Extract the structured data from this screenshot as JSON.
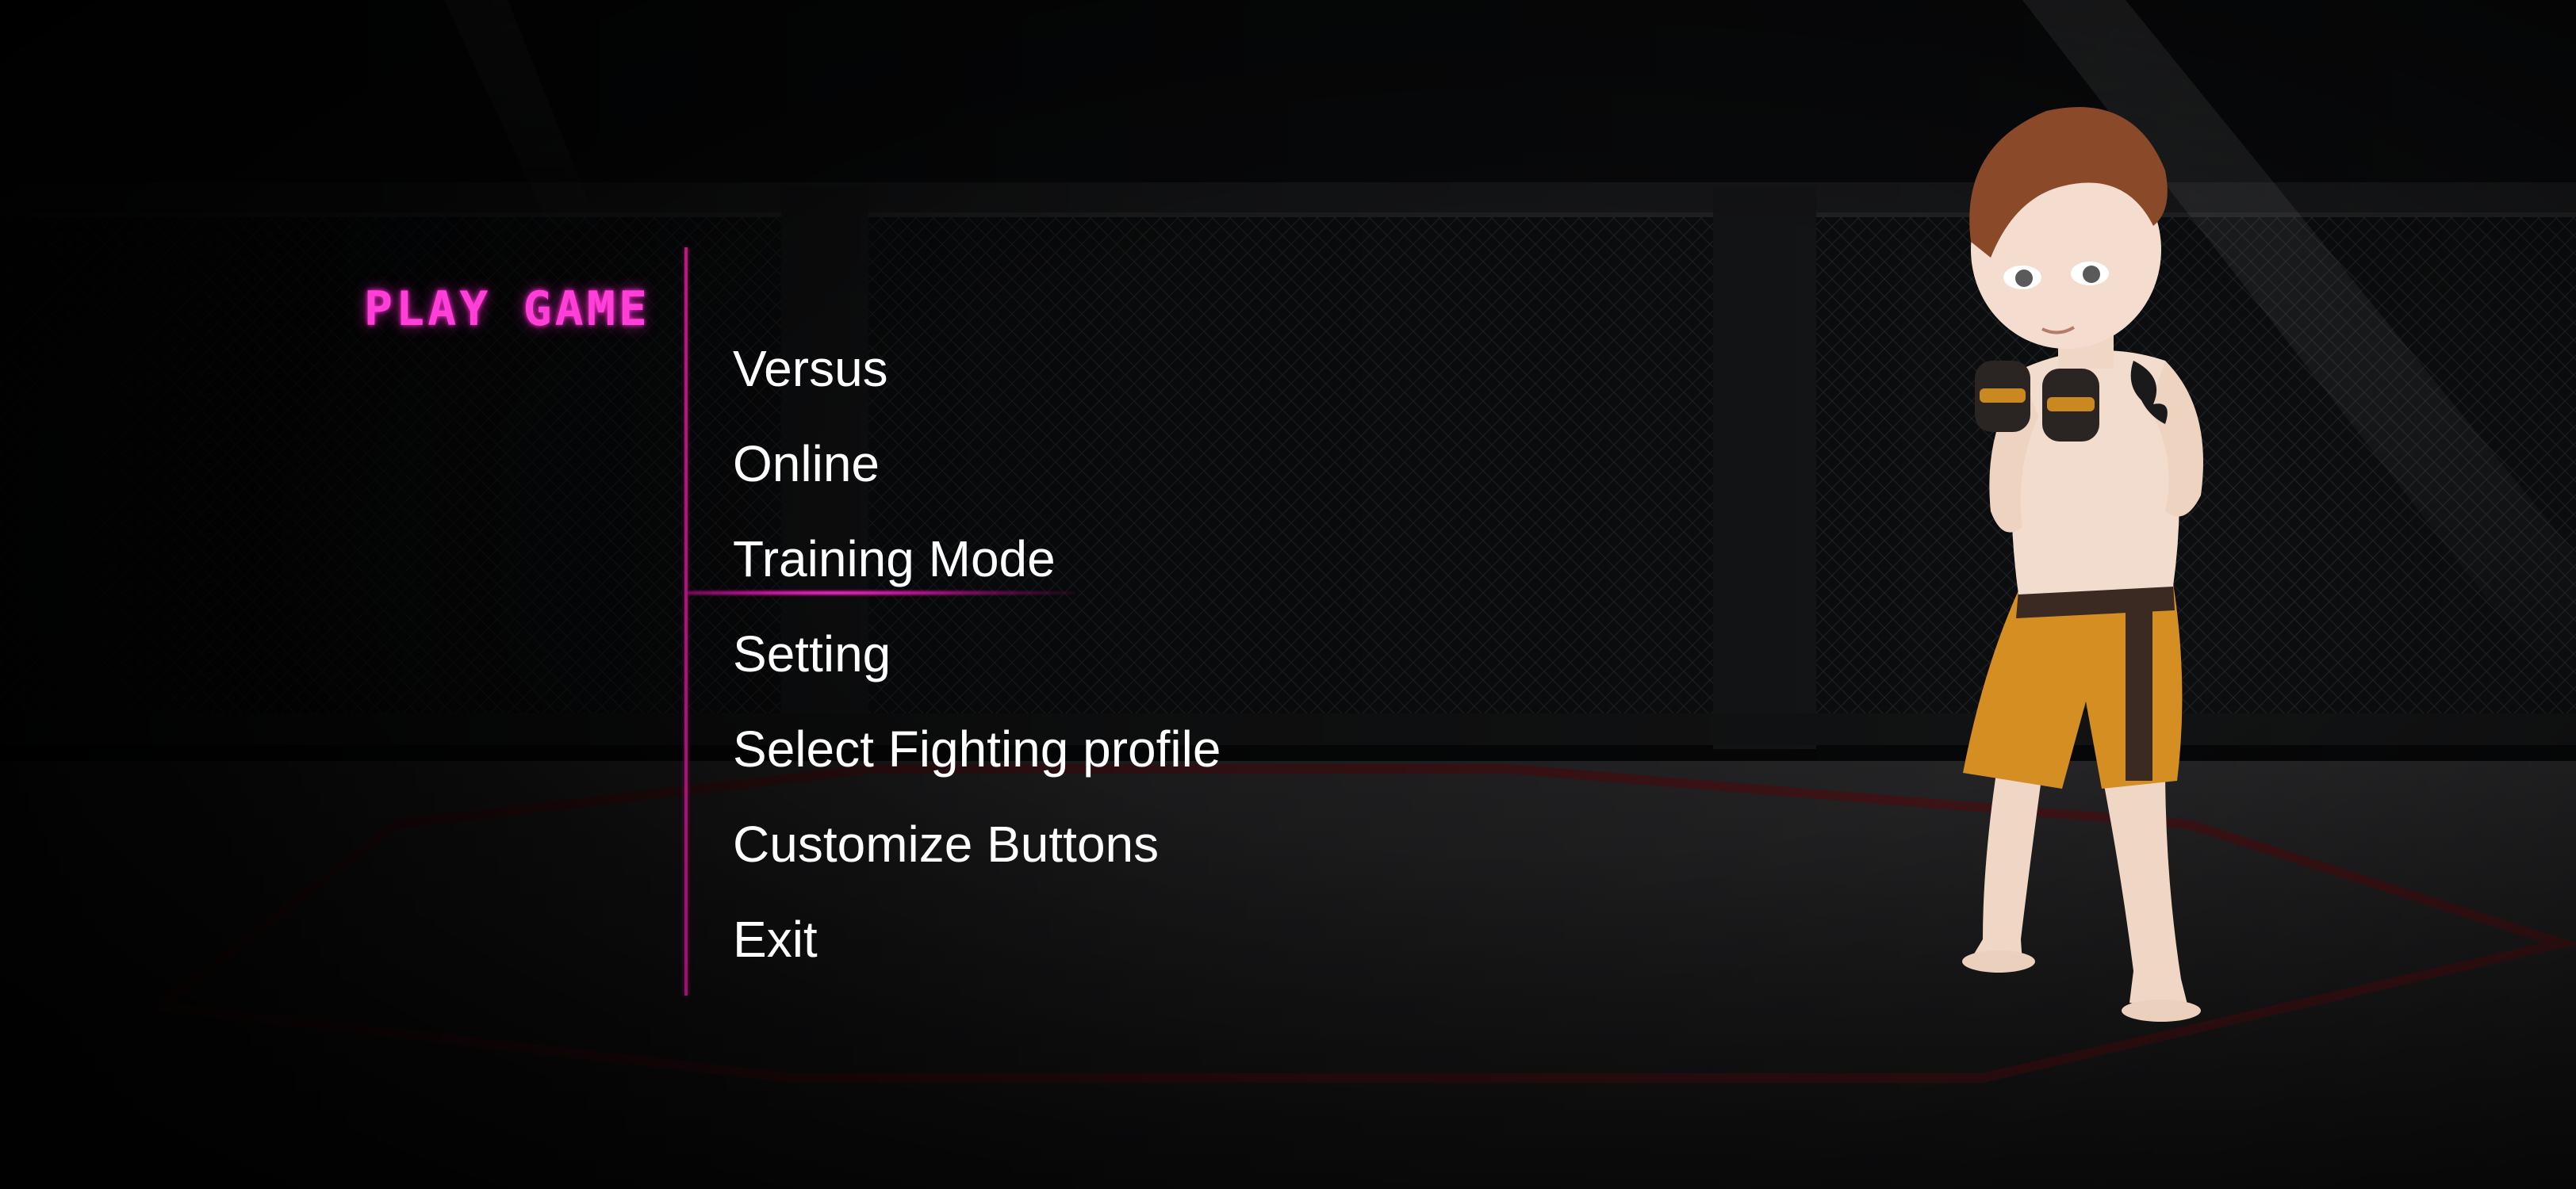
{
  "menu": {
    "title": "PLAY GAME",
    "items": [
      {
        "label": "Versus"
      },
      {
        "label": "Online"
      },
      {
        "label": "Training Mode",
        "selected": true
      },
      {
        "label": "Setting"
      },
      {
        "label": "Select Fighting profile"
      },
      {
        "label": "Customize Buttons"
      },
      {
        "label": "Exit"
      }
    ]
  },
  "colors": {
    "accent": "#ff3fd8",
    "divider": "#b0127a",
    "menu_text": "#ffffff",
    "background": "#050506",
    "shorts": "#d58e22"
  },
  "icons": {
    "character": "fighter-character"
  }
}
